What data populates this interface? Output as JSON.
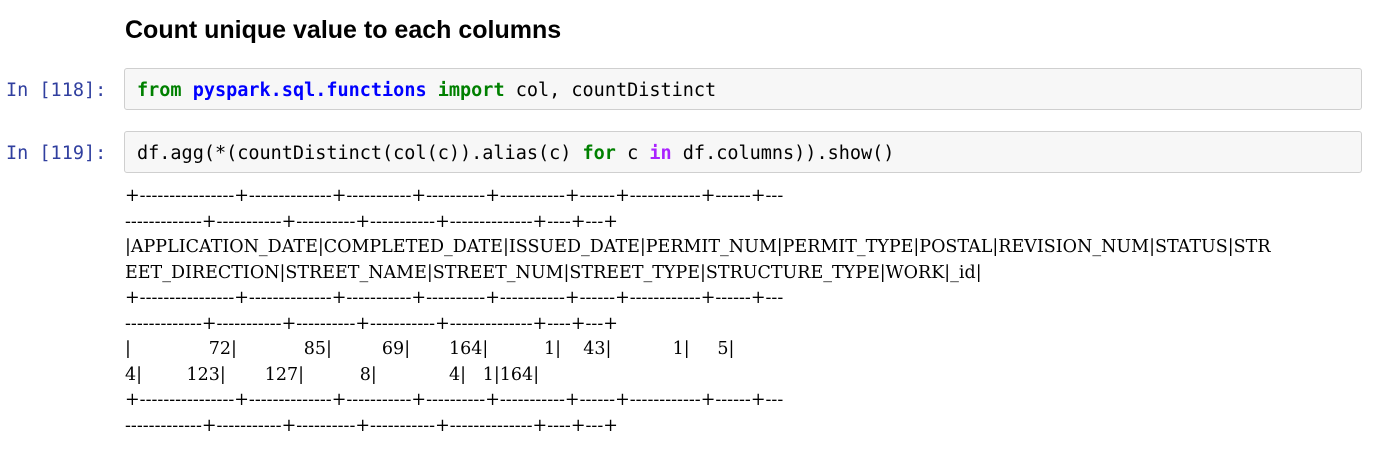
{
  "heading": "Count unique value to each columns",
  "cells": [
    {
      "prompt": "In [118]:",
      "code": [
        {
          "text": "from",
          "cls": "kw"
        },
        {
          "text": " ",
          "cls": ""
        },
        {
          "text": "pyspark.sql.functions",
          "cls": "mod"
        },
        {
          "text": " ",
          "cls": ""
        },
        {
          "text": "import",
          "cls": "kw"
        },
        {
          "text": " col, countDistinct",
          "cls": ""
        }
      ]
    },
    {
      "prompt": "In [119]:",
      "code": [
        {
          "text": "df.agg(*(countDistinct(col(c)).alias(c) ",
          "cls": ""
        },
        {
          "text": "for",
          "cls": "kw"
        },
        {
          "text": " c ",
          "cls": ""
        },
        {
          "text": "in",
          "cls": "ow"
        },
        {
          "text": " df.columns)).show()",
          "cls": ""
        }
      ]
    }
  ],
  "output_lines": [
    "+----------------+--------------+-----------+----------+-----------+------+------------+------+---",
    "-------------+-----------+----------+-----------+--------------+----+---+",
    "|APPLICATION_DATE|COMPLETED_DATE|ISSUED_DATE|PERMIT_NUM|PERMIT_TYPE|POSTAL|REVISION_NUM|STATUS|STR",
    "EET_DIRECTION|STREET_NAME|STREET_NUM|STREET_TYPE|STRUCTURE_TYPE|WORK|_id|",
    "+----------------+--------------+-----------+----------+-----------+------+------------+------+---",
    "-------------+-----------+----------+-----------+--------------+----+---+",
    "|              72|            85|         69|       164|          1|    43|           1|     5|",
    "4|        123|       127|          8|             4|   1|164|",
    "+----------------+--------------+-----------+----------+-----------+------+------------+------+---",
    "-------------+-----------+----------+-----------+--------------+----+---+"
  ]
}
